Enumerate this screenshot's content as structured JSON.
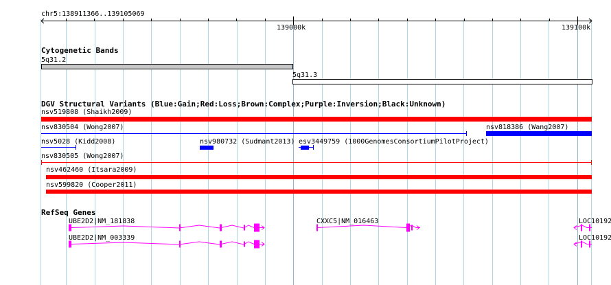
{
  "ruler": {
    "region": "chr5:138911366..139105069",
    "ticks": [
      {
        "label": "139000k"
      },
      {
        "label": "139100k"
      }
    ]
  },
  "cytobands": {
    "title": "Cytogenetic Bands",
    "bands": [
      {
        "name": "5q31.2",
        "fill": "#c8c8c8"
      },
      {
        "name": "5q31.3",
        "fill": "#ffffff"
      }
    ]
  },
  "dgv": {
    "title": "DGV Structural Variants (Blue:Gain;Red:Loss;Brown:Complex;Purple:Inversion;Black:Unknown)",
    "features": [
      {
        "label": "nsv519808 (Shaikh2009)",
        "color": "#ff0000",
        "type": "Loss"
      },
      {
        "label": "nsv830504 (Wong2007)",
        "color": "#0000ff",
        "type": "Gain"
      },
      {
        "label": "nsv818386 (Wang2007)",
        "color": "#0000ff",
        "type": "Gain"
      },
      {
        "label": "nsv5028 (Kidd2008)",
        "color": "#0000ff",
        "type": "Gain"
      },
      {
        "label": "nsv980732 (Sudmant2013)",
        "color": "#0000ff",
        "type": "Gain"
      },
      {
        "label": "esv3449759 (1000GenomesConsortiumPilotProject)",
        "color": "#0000ff",
        "type": "Gain"
      },
      {
        "label": "nsv830505 (Wong2007)",
        "color": "#ff0000",
        "type": "Loss"
      },
      {
        "label": "nsv462460 (Itsara2009)",
        "color": "#ff0000",
        "type": "Loss"
      },
      {
        "label": "nsv599820 (Cooper2011)",
        "color": "#ff0000",
        "type": "Loss"
      }
    ]
  },
  "refseq": {
    "title": "RefSeq Genes",
    "color": "#ff00ff",
    "genes": [
      {
        "label": "UBE2D2|NM_181838"
      },
      {
        "label": "UBE2D2|NM_003339"
      },
      {
        "label": "CXXC5|NM_016463"
      },
      {
        "label": "LOC10192"
      },
      {
        "label": "LOC10192"
      }
    ]
  }
}
